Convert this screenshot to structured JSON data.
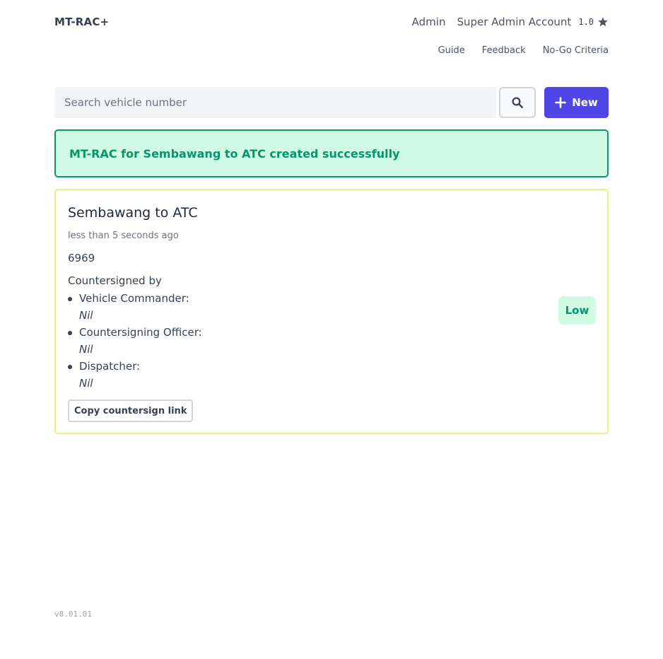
{
  "header": {
    "brand": "MT-RAC+",
    "admin_link": "Admin",
    "account_name": "Super Admin Account",
    "rating": "1.0",
    "rating_icon": "star-icon"
  },
  "sub_nav": {
    "guide": "Guide",
    "feedback": "Feedback",
    "no_go": "No-Go Criteria"
  },
  "search": {
    "placeholder": "Search vehicle number",
    "value": "",
    "button_icon": "search-icon"
  },
  "new_button": {
    "icon": "plus-icon",
    "label": "New"
  },
  "alert": {
    "message": "MT-RAC for Sembawang to ATC created successfully",
    "color": "#059669"
  },
  "card": {
    "title": "Sembawang to ATC",
    "time": "less than 5 seconds ago",
    "vehicle": "6969",
    "countersigned_label": "Countersigned by",
    "signers": [
      {
        "role": "Vehicle Commander:",
        "value": "Nil"
      },
      {
        "role": "Countersigning Officer:",
        "value": "Nil"
      },
      {
        "role": "Dispatcher:",
        "value": "Nil"
      }
    ],
    "copy_button": "Copy countersign link",
    "risk": "Low",
    "border_color": "#fde68a"
  },
  "footer": {
    "version": "v8.01.01"
  },
  "colors": {
    "accent": "#4f46e5",
    "success": "#059669",
    "success_bg": "#d1fae5"
  }
}
